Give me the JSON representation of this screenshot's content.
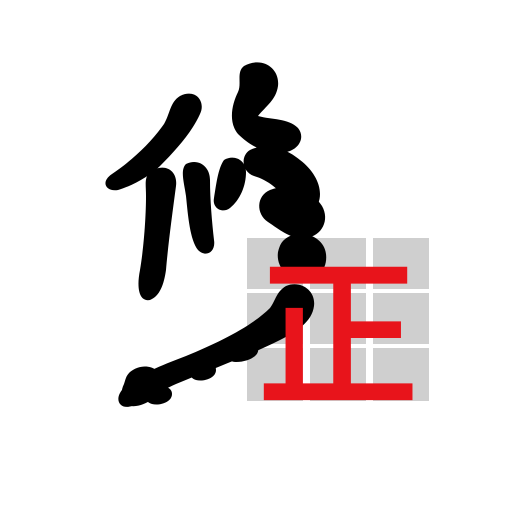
{
  "logo": {
    "brush_char": "修",
    "seal_char": "正",
    "brush_color": "#000000",
    "seal_color": "#e8141b",
    "grid_color": "#cfcfcf",
    "background": "#ffffff",
    "grid": {
      "rows": 3,
      "cols": 3
    }
  }
}
